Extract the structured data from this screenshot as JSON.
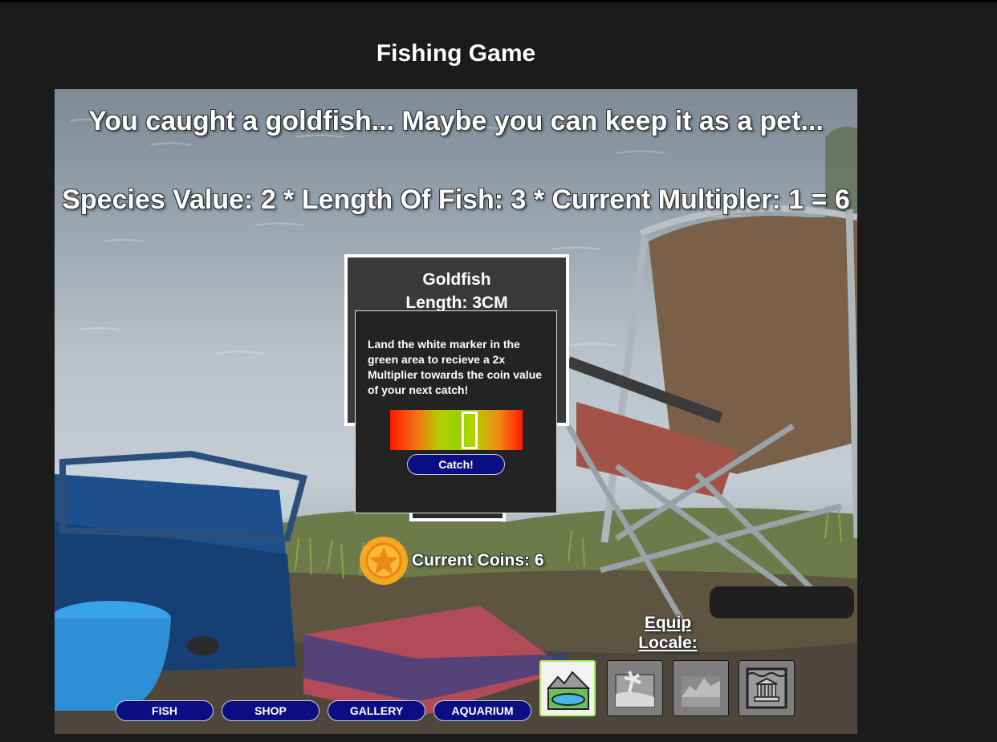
{
  "page": {
    "title": "Fishing Game"
  },
  "catch": {
    "message": "You caught a goldfish... Maybe you can keep it as a pet...",
    "equation": "Species Value: 2 * Length Of Fish: 3 * Current Multipler: 1 = 6"
  },
  "fish_card": {
    "name": "Goldfish",
    "length": "Length: 3CM"
  },
  "minigame": {
    "instructions": "Land the white marker in the green area to recieve a 2x Multiplier towards the coin value of your next catch!",
    "catch_label": "Catch!",
    "marker_position": 0.6,
    "colors": {
      "edge": "#ff1a00",
      "target": "#9ad100",
      "marker": "#ffffff"
    }
  },
  "coins": {
    "label": "Current Coins: 6",
    "icon": "star-coin-icon"
  },
  "locale": {
    "label": "Equip Locale:",
    "options": [
      {
        "icon": "lake-mountains-icon",
        "selected": true
      },
      {
        "icon": "beach-palm-icon",
        "selected": false
      },
      {
        "icon": "mountain-range-icon",
        "selected": false
      },
      {
        "icon": "underwater-ruins-icon",
        "selected": false
      }
    ]
  },
  "nav": {
    "fish": "FISH",
    "shop": "SHOP",
    "gallery": "GALLERY",
    "aquarium": "AQUARIUM"
  },
  "colors": {
    "background": "#1b1b1b",
    "button": "#0b0e83",
    "selected_border": "#a9f05a",
    "coin": "#f5a623"
  }
}
